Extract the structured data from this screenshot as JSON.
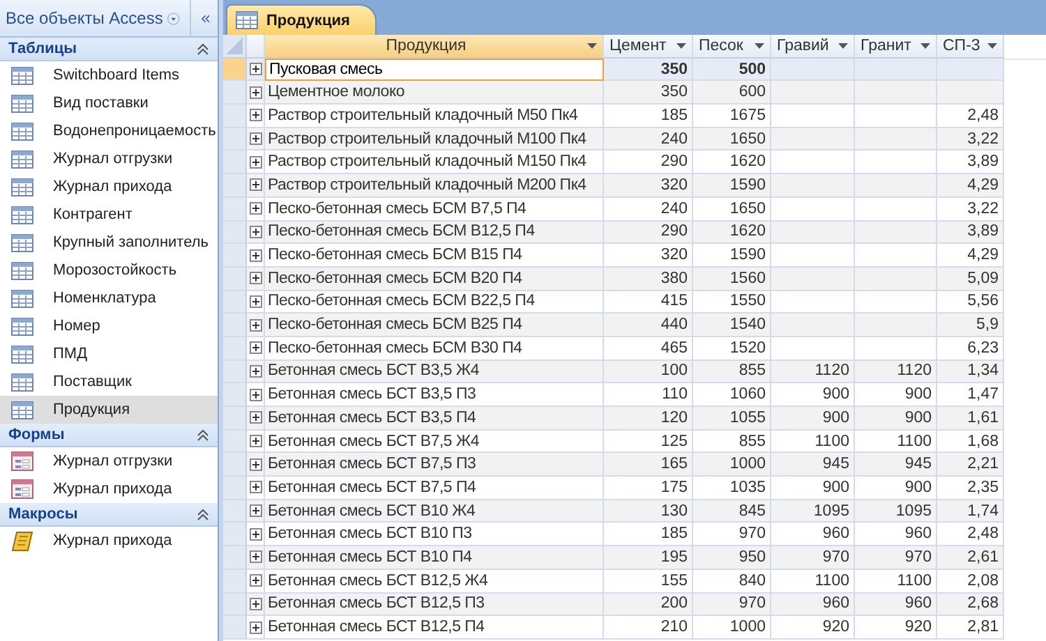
{
  "nav": {
    "title": "Все объекты Access",
    "sections": [
      {
        "title": "Таблицы",
        "kind": "table",
        "expanded": true,
        "items": [
          {
            "label": "Switchboard Items",
            "selected": false
          },
          {
            "label": "Вид поставки",
            "selected": false
          },
          {
            "label": "Водонепроницаемость",
            "selected": false
          },
          {
            "label": "Журнал отгрузки",
            "selected": false
          },
          {
            "label": "Журнал прихода",
            "selected": false
          },
          {
            "label": "Контрагент",
            "selected": false
          },
          {
            "label": "Крупный заполнитель",
            "selected": false
          },
          {
            "label": "Морозостойкость",
            "selected": false
          },
          {
            "label": "Номенклатура",
            "selected": false
          },
          {
            "label": "Номер",
            "selected": false
          },
          {
            "label": "ПМД",
            "selected": false
          },
          {
            "label": "Поставщик",
            "selected": false
          },
          {
            "label": "Продукция",
            "selected": true
          }
        ]
      },
      {
        "title": "Формы",
        "kind": "form",
        "expanded": true,
        "items": [
          {
            "label": "Журнал отгрузки",
            "selected": false
          },
          {
            "label": "Журнал прихода",
            "selected": false
          }
        ]
      },
      {
        "title": "Макросы",
        "kind": "macro",
        "expanded": true,
        "items": [
          {
            "label": "Журнал прихода",
            "selected": false
          }
        ]
      }
    ]
  },
  "tabs": [
    {
      "label": "Продукция",
      "selected": true
    }
  ],
  "table": {
    "columns": [
      "Продукция",
      "Цемент",
      "Песок",
      "Гравий",
      "Гранит",
      "СП-3"
    ],
    "rows": [
      {
        "current": true,
        "cells": [
          "Пусковая смесь",
          "350",
          "500",
          null,
          null,
          null
        ]
      },
      {
        "current": false,
        "cells": [
          "Цементное молоко",
          "350",
          "600",
          null,
          null,
          null
        ]
      },
      {
        "current": false,
        "cells": [
          "Раствор строительный кладочный М50 Пк4",
          "185",
          "1675",
          null,
          null,
          "2,48"
        ]
      },
      {
        "current": false,
        "cells": [
          "Раствор строительный кладочный М100 Пк4",
          "240",
          "1650",
          null,
          null,
          "3,22"
        ]
      },
      {
        "current": false,
        "cells": [
          "Раствор строительный кладочный М150 Пк4",
          "290",
          "1620",
          null,
          null,
          "3,89"
        ]
      },
      {
        "current": false,
        "cells": [
          "Раствор строительный кладочный М200 Пк4",
          "320",
          "1590",
          null,
          null,
          "4,29"
        ]
      },
      {
        "current": false,
        "cells": [
          "Песко-бетонная смесь БСМ В7,5 П4",
          "240",
          "1650",
          null,
          null,
          "3,22"
        ]
      },
      {
        "current": false,
        "cells": [
          "Песко-бетонная смесь БСМ В12,5 П4",
          "290",
          "1620",
          null,
          null,
          "3,89"
        ]
      },
      {
        "current": false,
        "cells": [
          "Песко-бетонная смесь БСМ В15 П4",
          "320",
          "1590",
          null,
          null,
          "4,29"
        ]
      },
      {
        "current": false,
        "cells": [
          "Песко-бетонная смесь БСМ В20 П4",
          "380",
          "1560",
          null,
          null,
          "5,09"
        ]
      },
      {
        "current": false,
        "cells": [
          "Песко-бетонная смесь БСМ В22,5 П4",
          "415",
          "1550",
          null,
          null,
          "5,56"
        ]
      },
      {
        "current": false,
        "cells": [
          "Песко-бетонная смесь БСМ В25 П4",
          "440",
          "1540",
          null,
          null,
          "5,9"
        ]
      },
      {
        "current": false,
        "cells": [
          "Песко-бетонная смесь БСМ В30 П4",
          "465",
          "1520",
          null,
          null,
          "6,23"
        ]
      },
      {
        "current": false,
        "cells": [
          "Бетонная смесь БСТ В3,5 Ж4",
          "100",
          "855",
          "1120",
          "1120",
          "1,34"
        ]
      },
      {
        "current": false,
        "cells": [
          "Бетонная смесь БСТ В3,5 П3",
          "110",
          "1060",
          "900",
          "900",
          "1,47"
        ]
      },
      {
        "current": false,
        "cells": [
          "Бетонная смесь БСТ В3,5 П4",
          "120",
          "1055",
          "900",
          "900",
          "1,61"
        ]
      },
      {
        "current": false,
        "cells": [
          "Бетонная смесь БСТ В7,5 Ж4",
          "125",
          "855",
          "1100",
          "1100",
          "1,68"
        ]
      },
      {
        "current": false,
        "cells": [
          "Бетонная смесь БСТ В7,5 П3",
          "165",
          "1000",
          "945",
          "945",
          "2,21"
        ]
      },
      {
        "current": false,
        "cells": [
          "Бетонная смесь БСТ В7,5 П4",
          "175",
          "1035",
          "900",
          "900",
          "2,35"
        ]
      },
      {
        "current": false,
        "cells": [
          "Бетонная смесь БСТ В10 Ж4",
          "130",
          "845",
          "1095",
          "1095",
          "1,74"
        ]
      },
      {
        "current": false,
        "cells": [
          "Бетонная смесь БСТ В10 П3",
          "185",
          "970",
          "960",
          "960",
          "2,48"
        ]
      },
      {
        "current": false,
        "cells": [
          "Бетонная смесь БСТ В10 П4",
          "195",
          "950",
          "970",
          "970",
          "2,61"
        ]
      },
      {
        "current": false,
        "cells": [
          "Бетонная смесь БСТ В12,5 Ж4",
          "155",
          "840",
          "1100",
          "1100",
          "2,08"
        ]
      },
      {
        "current": false,
        "cells": [
          "Бетонная смесь БСТ В12,5 П3",
          "200",
          "970",
          "960",
          "960",
          "2,68"
        ]
      },
      {
        "current": false,
        "cells": [
          "Бетонная смесь БСТ В12,5 П4",
          "210",
          "1000",
          "920",
          "920",
          "2,81"
        ]
      }
    ]
  }
}
